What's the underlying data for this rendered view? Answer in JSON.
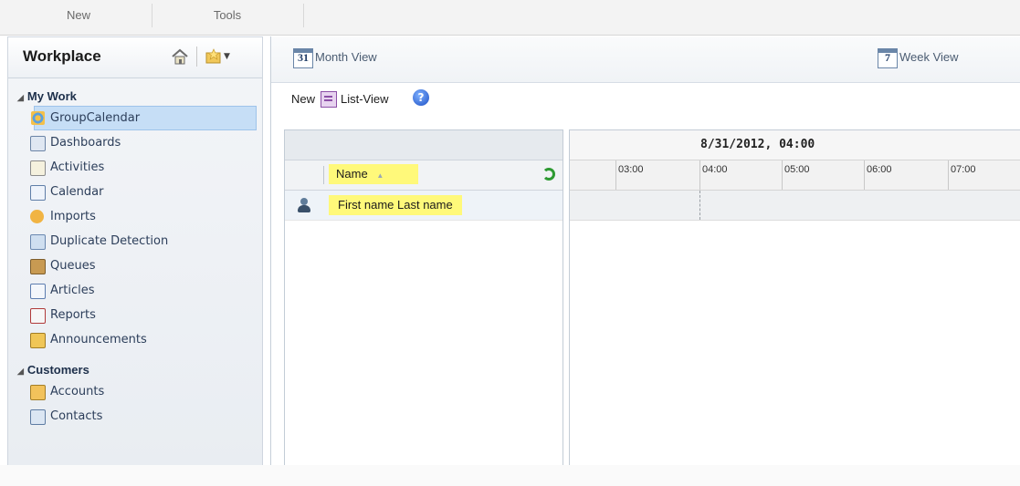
{
  "ribbon": {
    "tabs": [
      "New",
      "Tools"
    ]
  },
  "nav": {
    "title": "Workplace",
    "groups": [
      {
        "title": "My Work",
        "items": [
          {
            "label": "GroupCalendar",
            "selected": true
          },
          {
            "label": "Dashboards"
          },
          {
            "label": "Activities"
          },
          {
            "label": "Calendar"
          },
          {
            "label": "Imports"
          },
          {
            "label": "Duplicate Detection"
          },
          {
            "label": "Queues"
          },
          {
            "label": "Articles"
          },
          {
            "label": "Reports"
          },
          {
            "label": "Announcements"
          }
        ]
      },
      {
        "title": "Customers",
        "items": [
          {
            "label": "Accounts"
          },
          {
            "label": "Contacts"
          }
        ]
      }
    ]
  },
  "views": {
    "month": {
      "icon_text": "31",
      "label": "Month View"
    },
    "week": {
      "icon_text": "7",
      "label": "Week View"
    }
  },
  "toolbar": {
    "new_label": "New",
    "list_view_label": "List-View",
    "help_icon_text": "?"
  },
  "grid": {
    "column_header": "Name",
    "rows": [
      {
        "name": "First name Last name"
      }
    ],
    "date_header": "8/31/2012, 04:00",
    "hours": [
      "03:00",
      "04:00",
      "05:00",
      "06:00",
      "07:00"
    ]
  },
  "colors": {
    "highlight": "#fff97a",
    "selected_bg": "#c6def6"
  }
}
